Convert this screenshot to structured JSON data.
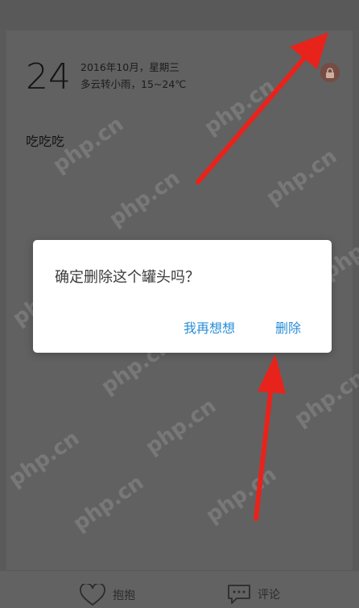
{
  "entry": {
    "day": "24",
    "date_line": "2016年10月，星期三",
    "weather_line": "多云转小雨，15~24℃",
    "text": "吃吃吃"
  },
  "dialog": {
    "message": "确定删除这个罐头吗？",
    "cancel_label": "我再想想",
    "delete_label": "删除"
  },
  "bottom_bar": {
    "hug_label": "抱抱",
    "comment_label": "评论"
  },
  "watermark": "php.cn",
  "colors": {
    "accent": "#2a8ed8",
    "arrow": "#e8231c",
    "lock": "#7d5147"
  }
}
